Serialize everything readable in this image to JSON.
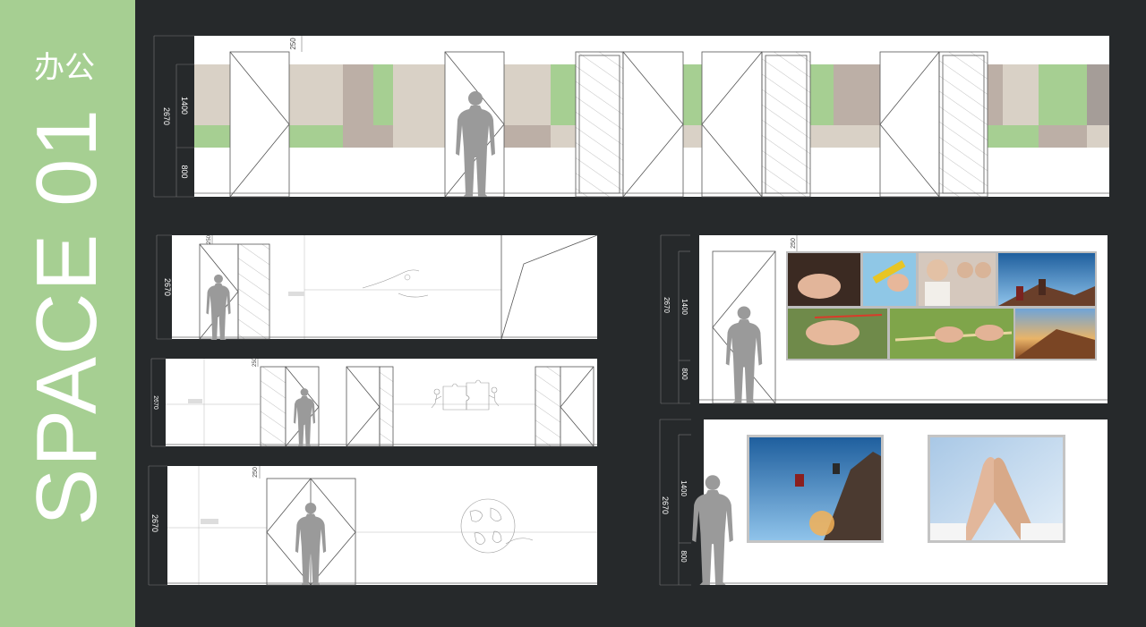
{
  "sidebar": {
    "title": "SPACE 01",
    "subtitle": "办公"
  },
  "dimensions": {
    "total_height": "2670",
    "band_height": "1400",
    "base_height": "800",
    "top_offset": "250"
  },
  "colors": {
    "sidebar_green": "#a6cf92",
    "background": "#26292b",
    "panel_beige": "#d9d1c6",
    "panel_taupe": "#bcafa6",
    "panel_green": "#a6cf92",
    "panel_grey": "#a59d98",
    "figure_grey": "#9a9a9a"
  }
}
